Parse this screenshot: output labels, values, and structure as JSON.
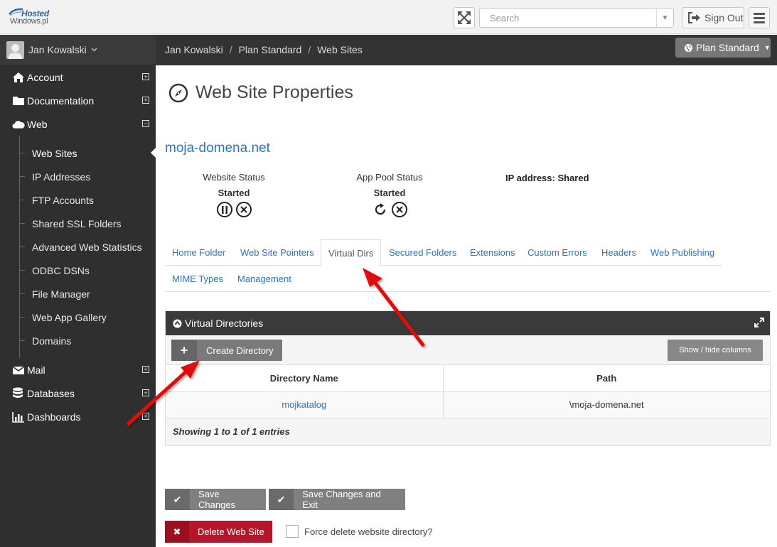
{
  "header": {
    "logo_text_top": "Hosted",
    "logo_text_bottom": "Windows.pl",
    "search_placeholder": "Search",
    "signout_label": "Sign Out"
  },
  "sidebar": {
    "user_name": "Jan Kowalski",
    "items": [
      {
        "label": "Account",
        "icon": "home-icon",
        "toggle": "⊞"
      },
      {
        "label": "Documentation",
        "icon": "folder-icon",
        "toggle": "⊞"
      },
      {
        "label": "Web",
        "icon": "cloud-icon",
        "toggle": "⊟"
      }
    ],
    "web_sub": [
      {
        "label": "Web Sites"
      },
      {
        "label": "IP Addresses"
      },
      {
        "label": "FTP Accounts"
      },
      {
        "label": "Shared SSL Folders"
      },
      {
        "label": "Advanced Web Statistics"
      },
      {
        "label": "ODBC DSNs"
      },
      {
        "label": "File Manager"
      },
      {
        "label": "Web App Gallery"
      },
      {
        "label": "Domains"
      }
    ],
    "items_after": [
      {
        "label": "Mail",
        "icon": "envelope-icon",
        "toggle": "⊞"
      },
      {
        "label": "Databases",
        "icon": "database-icon",
        "toggle": "⊞"
      },
      {
        "label": "Dashboards",
        "icon": "bar-chart-icon",
        "toggle": "⊞"
      }
    ]
  },
  "breadcrumb": [
    "Jan Kowalski",
    "Plan Standard",
    "Web Sites"
  ],
  "breadcrumb_sep": "/",
  "plan_button": "Plan Standard",
  "page": {
    "title": "Web Site Properties",
    "domain": "moja-domena.net",
    "website_status_label": "Website Status",
    "website_status_value": "Started",
    "apppool_status_label": "App Pool Status",
    "apppool_status_value": "Started",
    "ip_address": "IP address: Shared"
  },
  "tabs_row1": [
    "Home Folder",
    "Web Site Pointers",
    "Virtual Dirs",
    "Secured Folders",
    "Extensions",
    "Custom Errors",
    "Headers",
    "Web Publishing"
  ],
  "tabs_row2": [
    "MIME Types",
    "Management"
  ],
  "active_tab": "Virtual Dirs",
  "panel": {
    "title": "Virtual Directories",
    "create_label": "Create Directory",
    "showhide_label": "Show / hide columns",
    "columns": [
      "Directory Name",
      "Path"
    ],
    "rows": [
      [
        "mojkatalog",
        "\\moja-domena.net"
      ]
    ],
    "showing": "Showing 1 to 1 of 1 entries"
  },
  "actions": {
    "save": "Save Changes",
    "save_exit": "Save Changes and Exit",
    "delete": "Delete Web Site",
    "force_delete": "Force delete website directory?"
  },
  "colors": {
    "link": "#2b76b9",
    "sidebar_bg": "#2f2f2f",
    "delete_red": "#b7162a",
    "arrow_red": "#e01010"
  }
}
